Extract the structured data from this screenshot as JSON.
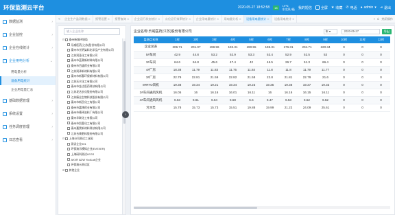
{
  "header": {
    "title": "环保监测云平台",
    "datetime": "2020-05-27 18:52:58",
    "weather_badge": "18",
    "weather_temp": "19℃",
    "weather_city": "东北风2级",
    "msg_label": "我的短信",
    "fullscreen_label": "全屏",
    "favorite_label": "收藏",
    "phone_label": "电话",
    "user_label": "admin",
    "logout_label": "退出"
  },
  "tabs": {
    "items": [
      {
        "label": "企业生产监测数据",
        "active": false
      },
      {
        "label": "报警设置",
        "active": false
      },
      {
        "label": "报警查询",
        "active": false
      },
      {
        "label": "企业运行状态统计",
        "active": false
      },
      {
        "label": "点位运行效率统计",
        "active": false
      },
      {
        "label": "企业用电量统计",
        "active": false
      },
      {
        "label": "用电量分析",
        "active": false
      },
      {
        "label": "设备用电量统计",
        "active": true
      },
      {
        "label": "设备用电统计",
        "active": false
      }
    ],
    "close_all": "关闭操作"
  },
  "sidebar": {
    "items": [
      {
        "label": "数据监测",
        "open": false
      },
      {
        "label": "企业监控",
        "open": false
      },
      {
        "label": "企业在线统计",
        "open": false
      },
      {
        "label": "企业用电分析",
        "open": true
      }
    ],
    "sub_items": [
      {
        "label": "用电量分析",
        "active": false
      },
      {
        "label": "设备用电统计",
        "active": true
      },
      {
        "label": "企业用电量汇总",
        "active": false
      }
    ],
    "bottom_items": [
      {
        "label": "基础数据管理"
      },
      {
        "label": "系统设置"
      },
      {
        "label": "任务调度管理"
      },
      {
        "label": "日志查看"
      }
    ]
  },
  "tree": {
    "search_placeholder": "输入企业名称",
    "nodes": [
      {
        "label": "泰州新城环境局",
        "level": 1,
        "toggle": "⊟"
      },
      {
        "label": "乐威医药(江苏)股份有限公司",
        "level": 2
      },
      {
        "label": "泰州市光明染料化学品产业有限公司",
        "level": 2
      },
      {
        "label": "江苏润圣化工有限公司",
        "level": 2
      },
      {
        "label": "泰州市蓝潮新材料有限公司",
        "level": 2
      },
      {
        "label": "泰州市百盛药业有限公司",
        "level": 2
      },
      {
        "label": "江苏润泽新材料有限公司",
        "level": 2
      },
      {
        "label": "泰州市新春环保新材料有限公司",
        "level": 2
      },
      {
        "label": "江苏沃众化工有限公司",
        "level": 2
      },
      {
        "label": "泰州市金达医药科技有限公司",
        "level": 2
      },
      {
        "label": "江苏发达农化股份有限公司",
        "level": 2
      },
      {
        "label": "江苏康业生物科技股份有限公司",
        "level": 2
      },
      {
        "label": "泰州市新民化工有限公司",
        "level": 2
      },
      {
        "label": "泰州市嘉博药业有限公司",
        "level": 2
      },
      {
        "label": "泰州市德泽染料厂有限公司",
        "level": 2
      },
      {
        "label": "泰州华联化工有限公司",
        "level": 2
      },
      {
        "label": "泰州市凯蓉化工有限公司",
        "level": 2
      },
      {
        "label": "泰州嘉昊新材料科技有限公司",
        "level": 2
      },
      {
        "label": "江苏台美肥料股份有限公司",
        "level": 2
      },
      {
        "label": "上海分司测试工业园",
        "level": 1,
        "toggle": "⊟"
      },
      {
        "label": "测试企业001",
        "level": 2
      },
      {
        "label": "环保演示模拟企业(EVEXER)",
        "level": 2
      },
      {
        "label": "上海研科测试LEGS",
        "level": 2
      },
      {
        "label": "AKVR ADW YoolLab企业",
        "level": 2
      },
      {
        "label": "环保演示测试区",
        "level": 2
      },
      {
        "label": "其他企业",
        "level": 1,
        "toggle": "⊞"
      }
    ]
  },
  "main": {
    "title": "企业名称:乐威医药(江苏)股份有限公司",
    "year_select": "年",
    "date_value": "2020-05-27",
    "export_label": "导出",
    "columns": [
      "监测点名称",
      "1时",
      "2时",
      "3时",
      "4时",
      "5时",
      "6时",
      "7时",
      "8时",
      "9时",
      "10时",
      "11时",
      "12时"
    ],
    "rows": [
      [
        "企业总表",
        "206.71",
        "201.07",
        "198.96",
        "192.31",
        "190.55",
        "196.31",
        "176.31",
        "204.71",
        "220.34",
        "0",
        "0",
        "0"
      ],
      [
        "5#车间",
        "42.9",
        "44.8",
        "53.2",
        "52.9",
        "53.3",
        "53.4",
        "52.9",
        "52.5",
        "53",
        "0",
        "0",
        "0"
      ],
      [
        "3#车间",
        "64.6",
        "64.8",
        "45.6",
        "47.4",
        "42",
        "46.5",
        "26.7",
        "51.3",
        "66.4",
        "0",
        "0",
        "0"
      ],
      [
        "4#厂房",
        "18.38",
        "11.79",
        "11.83",
        "11.75",
        "11.84",
        "11.8",
        "11.8",
        "11.79",
        "11.77",
        "0",
        "0",
        "0"
      ],
      [
        "3#厂房",
        "22.79",
        "22.81",
        "21.59",
        "22.82",
        "21.58",
        "22.8",
        "21.81",
        "22.79",
        "21.6",
        "0",
        "0",
        "0"
      ],
      [
        "8#RTO风机",
        "19.38",
        "19.34",
        "19.21",
        "19.34",
        "19.23",
        "19.35",
        "19.36",
        "19.37",
        "19.33",
        "0",
        "0",
        "0"
      ],
      [
        "3#车间通风风机",
        "16.05",
        "16",
        "16.16",
        "16.01",
        "16.11",
        "16",
        "16.16",
        "16.15",
        "16.11",
        "0",
        "0",
        "0"
      ],
      [
        "4#车间通风风机",
        "6.63",
        "6.61",
        "6.64",
        "6.58",
        "6.6",
        "6.47",
        "6.53",
        "6.52",
        "6.52",
        "0",
        "0",
        "0"
      ],
      [
        "污水泵",
        "15.78",
        "15.73",
        "15.73",
        "15.51",
        "19.88",
        "19.99",
        "21.22",
        "24.09",
        "25.61",
        "0",
        "0",
        "0"
      ]
    ]
  }
}
